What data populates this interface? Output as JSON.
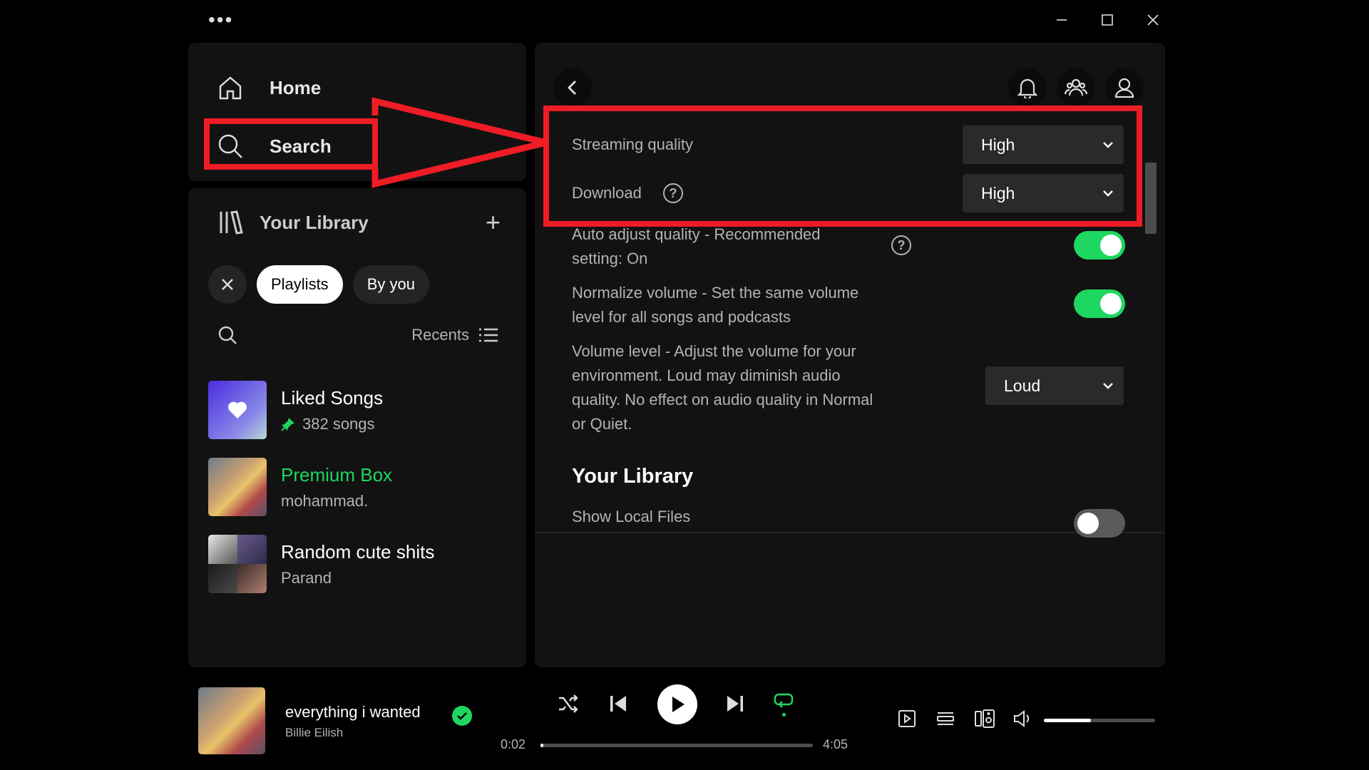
{
  "window": {
    "menu_dots": "•••"
  },
  "nav": {
    "home_label": "Home",
    "search_label": "Search"
  },
  "library": {
    "title": "Your Library",
    "add_label": "+",
    "filters": [
      "Playlists",
      "By you"
    ],
    "sort_label": "Recents",
    "items": [
      {
        "name": "Liked Songs",
        "subtitle": "382 songs",
        "pinned": true
      },
      {
        "name": "Premium Box",
        "subtitle": "mohammad."
      },
      {
        "name": "Random cute shits",
        "subtitle": "Parand"
      }
    ]
  },
  "settings": {
    "streaming_quality": {
      "label": "Streaming quality",
      "value": "High"
    },
    "download": {
      "label": "Download",
      "value": "High",
      "help_icon": "question-circle-icon"
    },
    "auto_adjust": {
      "label_line1": "Auto adjust quality - Recommended",
      "label_line2": "setting: On",
      "on": true
    },
    "normalize": {
      "label_line1": "Normalize volume - Set the same volume",
      "label_line2": "level for all songs and podcasts",
      "on": true
    },
    "volume_level": {
      "label_line1": "Volume level - Adjust the volume for your",
      "label_line2": "environment. Loud may diminish audio",
      "label_line3": "quality. No effect on audio quality in Normal",
      "label_line4": "or Quiet.",
      "value": "Loud"
    },
    "library_section": "Your Library",
    "show_local_files": {
      "label": "Show Local Files",
      "on": false
    }
  },
  "player": {
    "track": "everything i wanted",
    "artist": "Billie Eilish",
    "elapsed": "0:02",
    "duration": "4:05",
    "progress": 0.01,
    "volume": 0.42
  },
  "colors": {
    "accent": "#1ed760",
    "annotation": "#ee1c25",
    "panel": "#121212"
  }
}
